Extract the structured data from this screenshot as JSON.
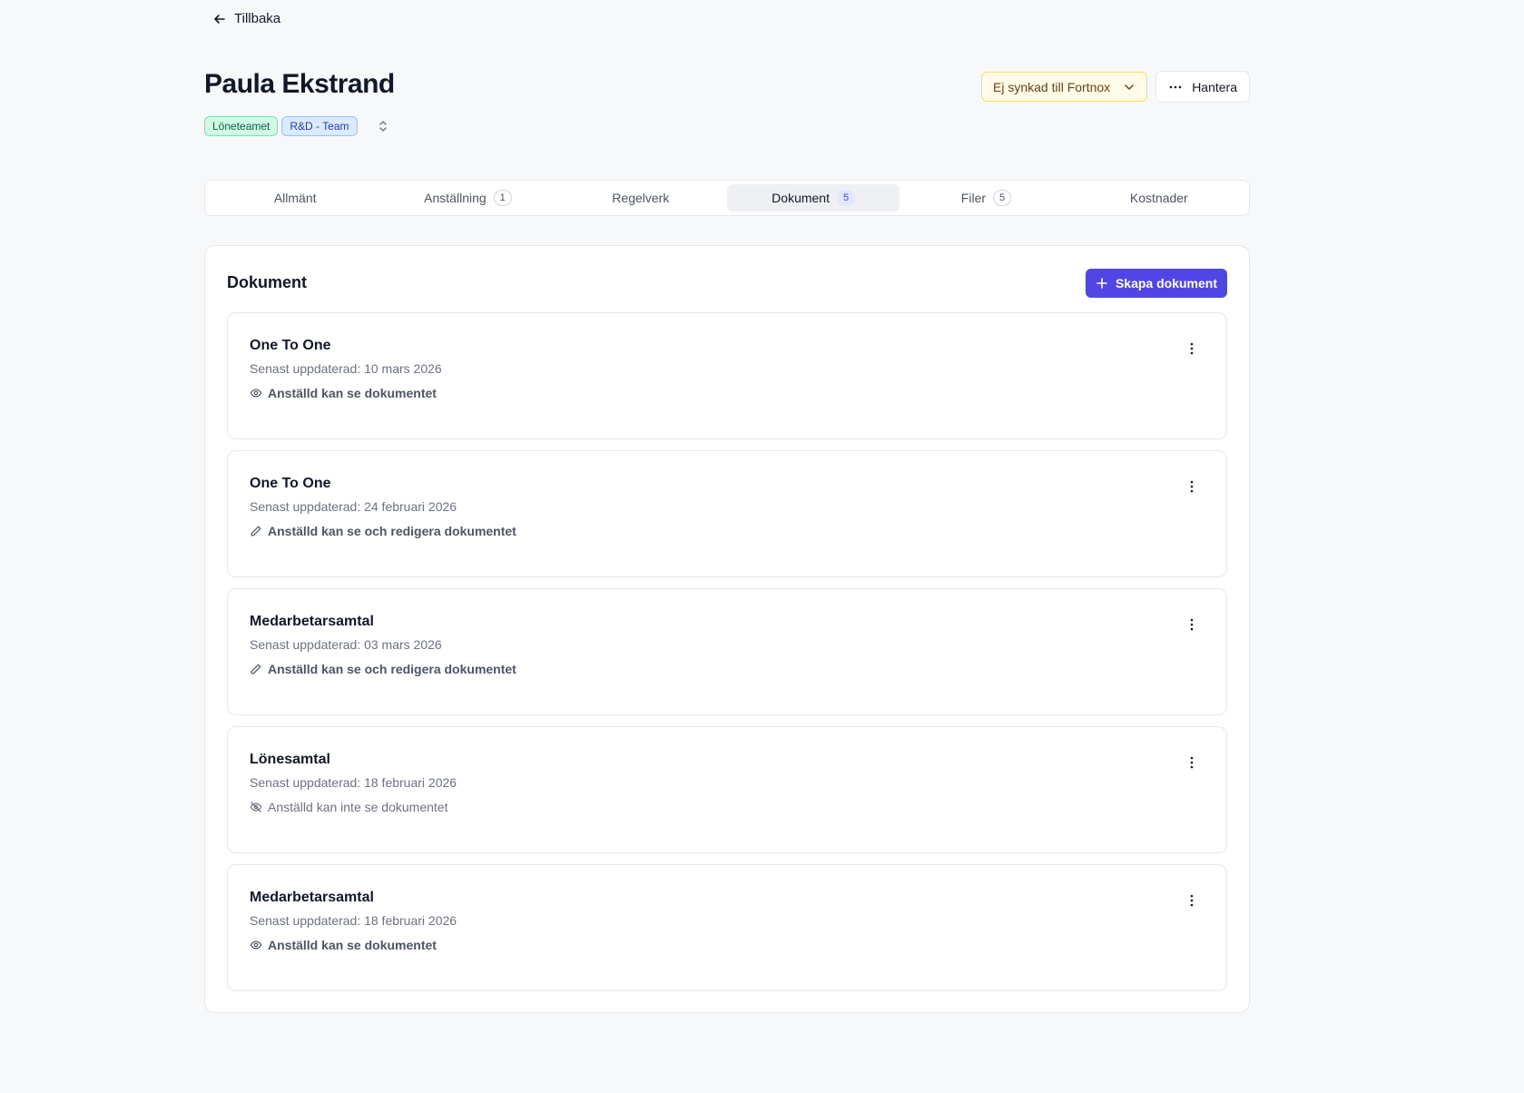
{
  "nav": {
    "back_label": "Tillbaka"
  },
  "employee": {
    "name": "Paula Ekstrand",
    "tags": [
      {
        "label": "Löneteamet",
        "color": "#d1fae5"
      },
      {
        "label": "R&D - Team",
        "color": "#dbeafe"
      }
    ]
  },
  "actions": {
    "sync_label": "Ej synkad till Fortnox",
    "manage_label": "Hantera"
  },
  "tabs": [
    {
      "label": "Allmänt",
      "count": null
    },
    {
      "label": "Anställning",
      "count": "1"
    },
    {
      "label": "Regelverk",
      "count": null
    },
    {
      "label": "Dokument",
      "count": "5",
      "active": true
    },
    {
      "label": "Filer",
      "count": "5"
    },
    {
      "label": "Kostnader",
      "count": null
    }
  ],
  "documents_panel": {
    "title": "Dokument",
    "create_label": "Skapa dokument",
    "accent_color": "#4f46e5"
  },
  "documents": [
    {
      "name": "One To One",
      "updated": "Senast uppdaterad: 10 mars 2026",
      "permission": "Anställd kan se dokumentet",
      "permission_icon": "eye-icon"
    },
    {
      "name": "One To One",
      "updated": "Senast uppdaterad: 24 februari 2026",
      "permission": "Anställd kan se och redigera dokumentet",
      "permission_icon": "pencil-icon"
    },
    {
      "name": "Medarbetarsamtal",
      "updated": "Senast uppdaterad: 03 mars 2026",
      "permission": "Anställd kan se och redigera dokumentet",
      "permission_icon": "pencil-icon"
    },
    {
      "name": "Lönesamtal",
      "updated": "Senast uppdaterad: 18 februari 2026",
      "permission": "Anställd kan inte se dokumentet",
      "permission_icon": "eye-off-icon"
    },
    {
      "name": "Medarbetarsamtal",
      "updated": "Senast uppdaterad: 18 februari 2026",
      "permission": "Anställd kan se dokumentet",
      "permission_icon": "eye-icon"
    }
  ]
}
